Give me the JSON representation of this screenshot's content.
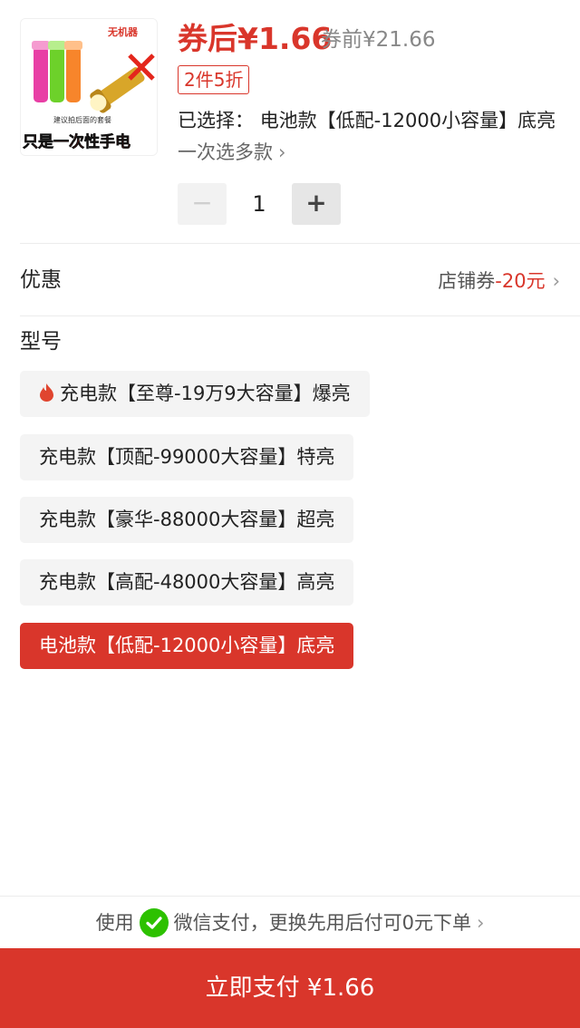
{
  "product": {
    "image_caption": "只是一次性手电",
    "image_badge": "无机器",
    "image_note": "建议拍后面的套餐",
    "price_after": "券后¥1.66",
    "price_before": "券前¥21.66",
    "promo_tag": "2件5折",
    "selected_label": "已选择：",
    "selected_value": "电池款【低配-12000小容量】底亮",
    "multi_select": "一次选多款",
    "quantity": "1",
    "minus": "−",
    "plus": "+"
  },
  "discount": {
    "label": "优惠",
    "value_prefix": "店铺券",
    "value_amount": "-20元"
  },
  "model": {
    "label": "型号",
    "options": [
      {
        "label": "充电款【至尊-19万9大容量】爆亮",
        "hot": true,
        "selected": false
      },
      {
        "label": "充电款【顶配-99000大容量】特亮",
        "hot": false,
        "selected": false
      },
      {
        "label": "充电款【豪华-88000大容量】超亮",
        "hot": false,
        "selected": false
      },
      {
        "label": "充电款【高配-48000大容量】高亮",
        "hot": false,
        "selected": false
      },
      {
        "label": "电池款【低配-12000小容量】底亮",
        "hot": false,
        "selected": true
      }
    ]
  },
  "payment": {
    "hint_prefix": "使用",
    "hint_main": "微信支付，更换先用后付可0元下单",
    "button_label": "立即支付 ¥1.66"
  },
  "icons": {
    "fire": "fire-icon",
    "wechat": "wechat-icon",
    "chevron": "chevron-right-icon"
  },
  "colors": {
    "accent": "#d9362b",
    "wechat": "#2dc100"
  }
}
